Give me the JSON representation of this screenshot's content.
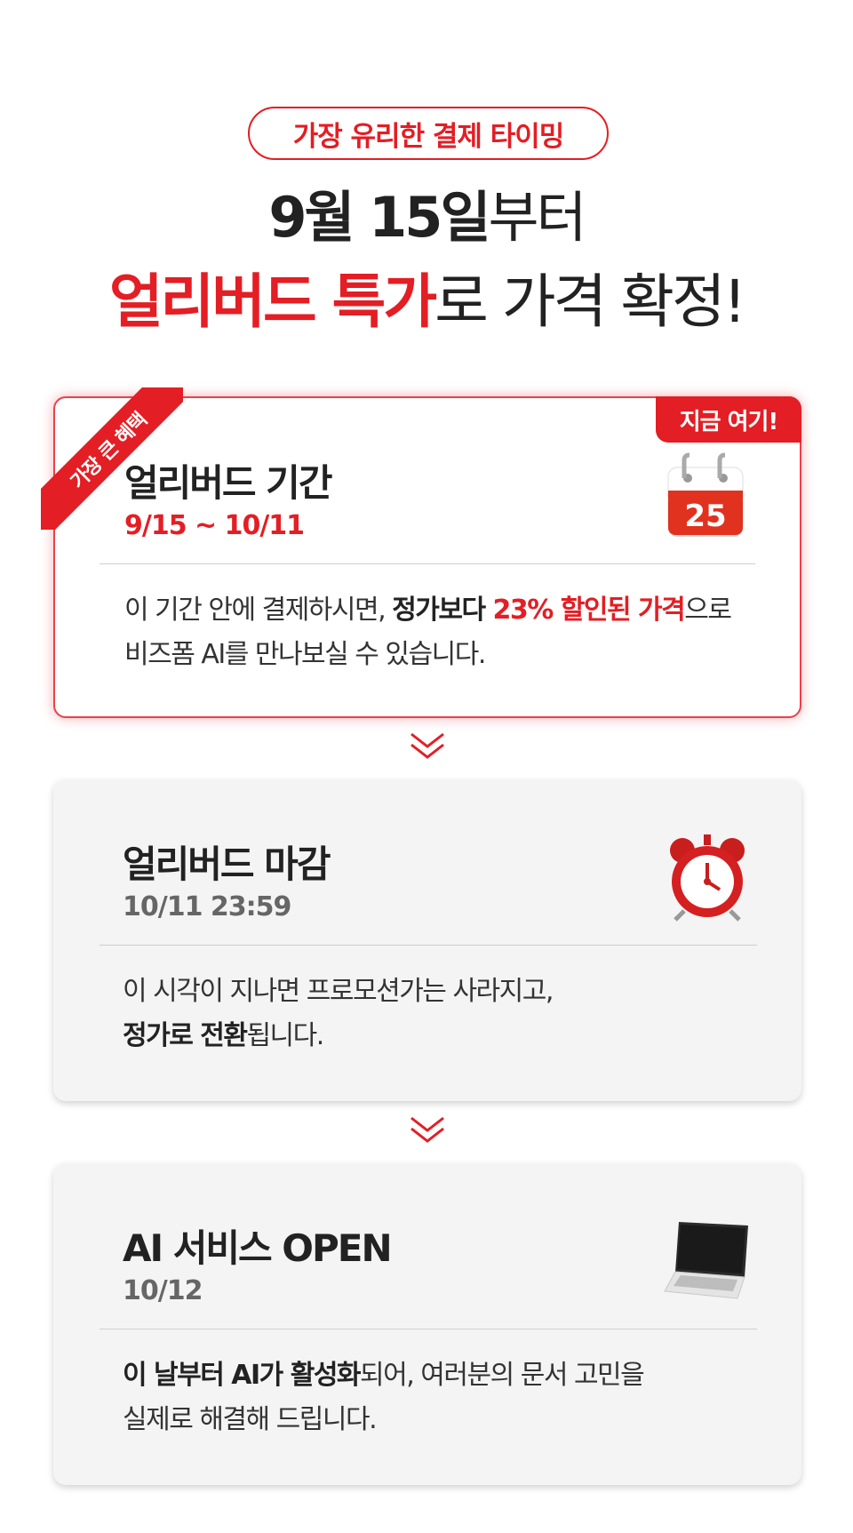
{
  "header": {
    "pill": "가장 유리한 결제 타이밍",
    "line1_bold": "9월 15일",
    "line1_rest": "부터",
    "line2_red": "얼리버드 특가",
    "line2_rest": "로 가격 확정!"
  },
  "steps": [
    {
      "badge": "가장 큰 혜택",
      "tag": "지금 여기!",
      "title": "얼리버드 기간",
      "date": "9/15 ~ 10/11",
      "icon": "calendar-icon",
      "icon_number": "25",
      "desc": {
        "p1": "이 기간 안에 결제하시면, ",
        "strong": "정가보다 ",
        "red": "23% 할인된 가격",
        "p2": "으로",
        "line2": "비즈폼 AI를 만나보실 수 있습니다."
      }
    },
    {
      "title": "얼리버드 마감",
      "date": "10/11 23:59",
      "icon": "alarm-clock-icon",
      "desc": {
        "line1": "이 시각이 지나면 프로모션가는 사라지고,",
        "strong": "정가로 전환",
        "rest": "됩니다."
      }
    },
    {
      "title": "AI 서비스 OPEN",
      "date": "10/12",
      "icon": "laptop-icon",
      "desc": {
        "strong": "이 날부터 AI가 활성화",
        "rest": "되어, 여러분의 문서 고민을",
        "line2": "실제로 해결해 드립니다."
      }
    }
  ],
  "colors": {
    "accent": "#e31e24",
    "card_bg": "#f4f4f4",
    "text": "#222222"
  }
}
